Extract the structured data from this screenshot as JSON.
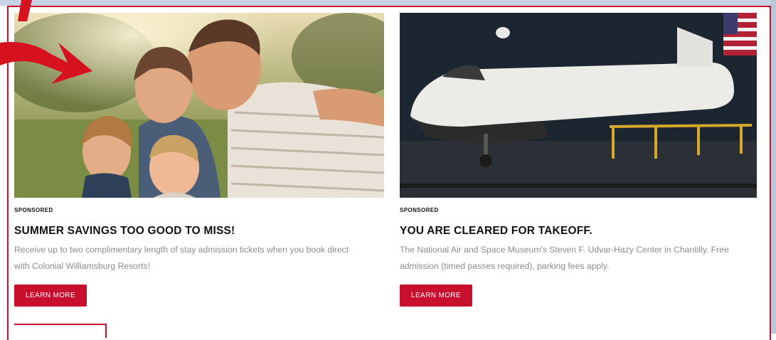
{
  "cards": [
    {
      "sponsored": "SPONSORED",
      "headline": "SUMMER SAVINGS TOO GOOD TO MISS!",
      "description": "Receive up to two complimentary length of stay admission tickets when you book direct with Colonial Williamsburg Resorts!",
      "button": "LEARN MORE"
    },
    {
      "sponsored": "SPONSORED",
      "headline": "YOU ARE CLEARED FOR TAKEOFF.",
      "description": "The National Air and Space Museum's Steven F. Udvar-Hazy Center in Chantilly. Free admission (timed passes required), parking fees apply.",
      "button": "LEARN MORE"
    }
  ],
  "colors": {
    "accent": "#c8102e",
    "headline": "#111111",
    "description": "#8b8b8b"
  },
  "icons": [
    "red-arrow-annotation"
  ]
}
